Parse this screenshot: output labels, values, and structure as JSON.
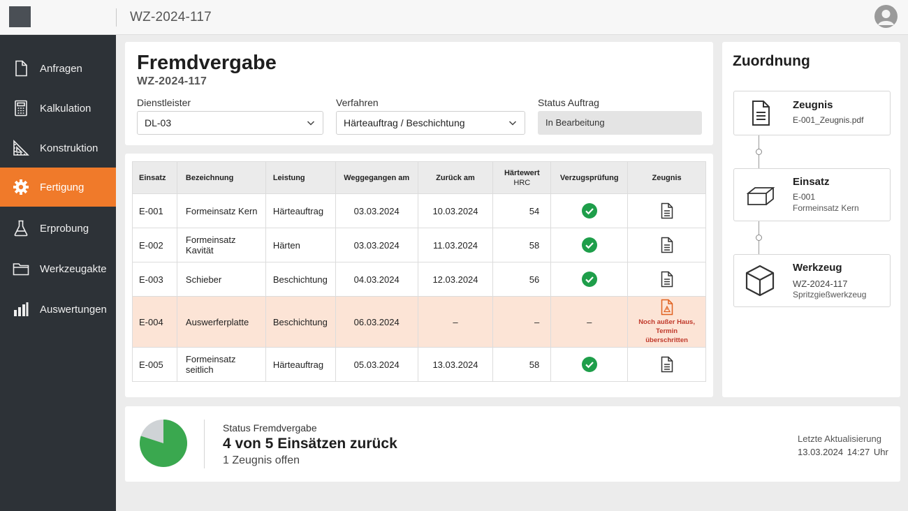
{
  "header": {
    "title": "WZ-2024-117"
  },
  "sidebar": {
    "items": [
      {
        "label": "Anfragen",
        "icon": "document-icon"
      },
      {
        "label": "Kalkulation",
        "icon": "calculator-icon"
      },
      {
        "label": "Konstruktion",
        "icon": "ruler-triangle-icon"
      },
      {
        "label": "Fertigung",
        "icon": "gear-icon",
        "active": true
      },
      {
        "label": "Erprobung",
        "icon": "flask-icon"
      },
      {
        "label": "Werkzeugakte",
        "icon": "folder-icon"
      },
      {
        "label": "Auswertungen",
        "icon": "bar-chart-icon"
      }
    ]
  },
  "form": {
    "title": "Fremdvergabe",
    "subtitle": "WZ-2024-117",
    "dienstleister_label": "Dienstleister",
    "dienstleister_value": "DL-03",
    "verfahren_label": "Verfahren",
    "verfahren_value": "Härteauftrag / Beschichtung",
    "status_label": "Status Auftrag",
    "status_value": "In Bearbeitung"
  },
  "table": {
    "headers": {
      "einsatz": "Einsatz",
      "bezeichnung": "Bezeichnung",
      "leistung": "Leistung",
      "weg": "Weggegangen am",
      "zurueck": "Zurück am",
      "haerte": "Härtewert",
      "haerte_unit": "HRC",
      "verzug": "Verzugsprüfung",
      "zeugnis": "Zeugnis"
    },
    "rows": [
      {
        "einsatz": "E-001",
        "bezeichnung": "Formeinsatz Kern",
        "leistung": "Härteauftrag",
        "weg": "03.03.2024",
        "zurueck": "10.03.2024",
        "haerte": "54",
        "verzug": "ok"
      },
      {
        "einsatz": "E-002",
        "bezeichnung": "Formeinsatz Kavität",
        "leistung": "Härten",
        "weg": "03.03.2024",
        "zurueck": "11.03.2024",
        "haerte": "58",
        "verzug": "ok"
      },
      {
        "einsatz": "E-003",
        "bezeichnung": "Schieber",
        "leistung": "Beschichtung",
        "weg": "04.03.2024",
        "zurueck": "12.03.2024",
        "haerte": "56",
        "verzug": "ok"
      },
      {
        "einsatz": "E-004",
        "bezeichnung": "Auswerferplatte",
        "leistung": "Beschichtung",
        "weg": "06.03.2024",
        "zurueck": "–",
        "haerte": "–",
        "verzug": "–",
        "note_line1": "Noch außer Haus,",
        "note_line2": "Termin überschritten"
      },
      {
        "einsatz": "E-005",
        "bezeichnung": "Formeinsatz seitlich",
        "leistung": "Härteauftrag",
        "weg": "05.03.2024",
        "zurueck": "13.03.2024",
        "haerte": "58",
        "verzug": "ok"
      }
    ]
  },
  "assignment": {
    "title": "Zuordnung",
    "zeugnis": {
      "title": "Zeugnis",
      "line1": "E-001_Zeugnis.pdf"
    },
    "einsatz": {
      "title": "Einsatz",
      "line1": "E-001",
      "line2": "Formeinsatz Kern"
    },
    "werkzeug": {
      "title": "Werkzeug",
      "line1": "WZ-2024-117",
      "line2": "Spritzgießwerkzeug"
    }
  },
  "status": {
    "label": "Status Fremdvergabe",
    "main": "4 von 5 Einsätzen zurück",
    "sub": "1 Zeugnis offen",
    "returned": 4,
    "total": 5,
    "update_label": "Letzte Aktualisierung",
    "update_date": "13.03.2024",
    "update_time": "14:27 Uhr"
  },
  "colors": {
    "accent": "#f07a2a",
    "sidebar": "#2d3237",
    "ok": "#1e9e4a",
    "warn_bg": "#fce4d6",
    "warn_text": "#c0392b",
    "pie_done": "#3aa84f",
    "pie_open": "#cfd3d6"
  }
}
